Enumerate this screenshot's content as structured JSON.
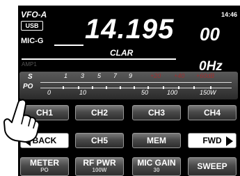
{
  "vfo_label": "VFO-A",
  "clock": "14:46",
  "mode": "USB",
  "mic_label": "MIC-G",
  "frequency_main": "14.195",
  "frequency_small": "00",
  "clar_label": "CLAR",
  "amp_label": "AMP1",
  "clar_offset": "0Hz",
  "meter": {
    "s_label": "S",
    "po_label": "PO",
    "s_ticks": [
      "1",
      "3",
      "5",
      "7",
      "9",
      "+20",
      "+40",
      "+60dB"
    ],
    "po_ticks": [
      "0",
      "10",
      "50",
      "100",
      "150W"
    ]
  },
  "buttons": {
    "row1": [
      "CH1",
      "CH2",
      "CH3",
      "CH4"
    ],
    "back": "BACK",
    "ch5": "CH5",
    "mem": "MEM",
    "fwd": "FWD",
    "meter": {
      "label": "METER",
      "sub": "PO"
    },
    "rfpwr": {
      "label": "RF PWR",
      "sub": "100W"
    },
    "micgain": {
      "label": "MIC GAIN",
      "sub": "30"
    },
    "sweep": "SWEEP"
  },
  "colors": {
    "panel": "#000000",
    "red_tick": "#a03030"
  }
}
